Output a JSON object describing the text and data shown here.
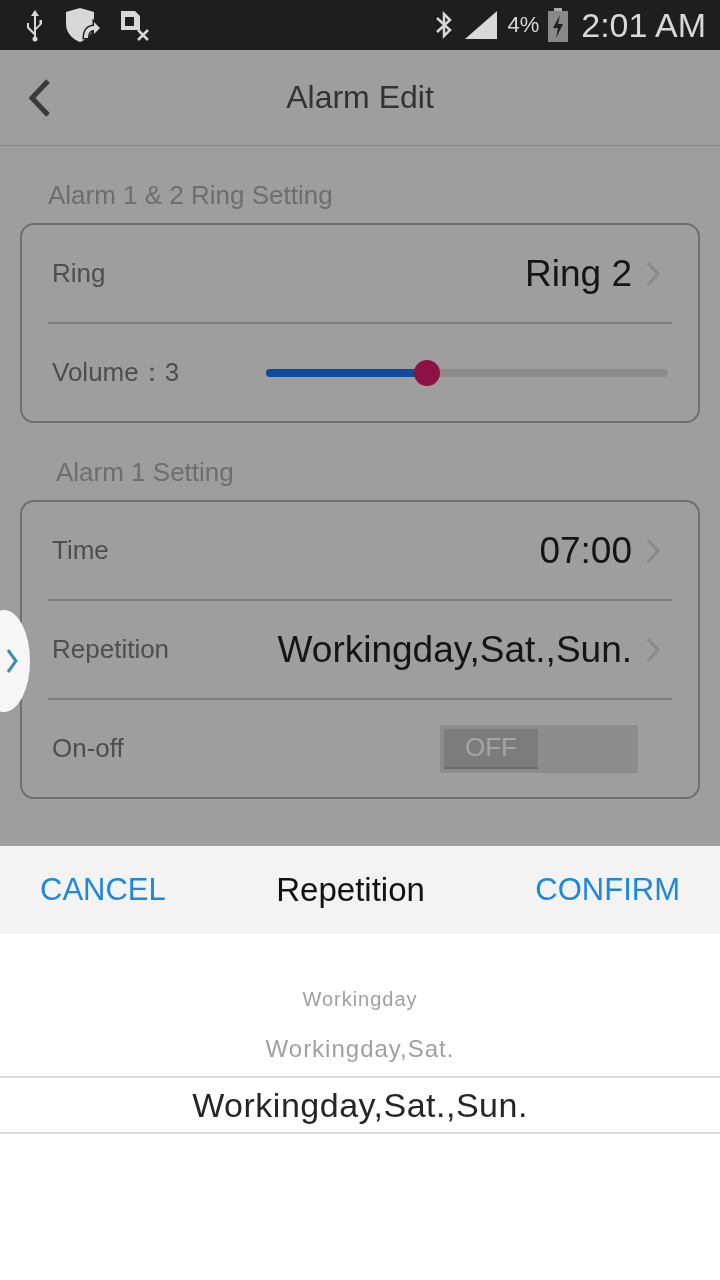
{
  "status_bar": {
    "battery": "4%",
    "time": "2:01 AM"
  },
  "header": {
    "title": "Alarm Edit"
  },
  "sections": [
    {
      "title": "Alarm 1 & 2 Ring Setting",
      "rows": [
        {
          "kind": "link",
          "label": "Ring",
          "value": "Ring 2"
        },
        {
          "kind": "slider",
          "label": "Volume：3",
          "level": 0.4
        }
      ]
    },
    {
      "title": "Alarm 1 Setting",
      "rows": [
        {
          "kind": "link",
          "label": "Time",
          "value": "07:00"
        },
        {
          "kind": "link",
          "label": "Repetition",
          "value": "Workingday,Sat.,Sun."
        },
        {
          "kind": "toggle",
          "label": "On-off",
          "on": false,
          "state_text": "OFF"
        }
      ]
    }
  ],
  "sheet": {
    "cancel": "CANCEL",
    "title": "Repetition",
    "confirm": "CONFIRM",
    "options": [
      {
        "label": "Workingday",
        "selected": false
      },
      {
        "label": "Workingday,Sat.",
        "selected": false
      },
      {
        "label": "Workingday,Sat.,Sun.",
        "selected": true
      }
    ]
  }
}
